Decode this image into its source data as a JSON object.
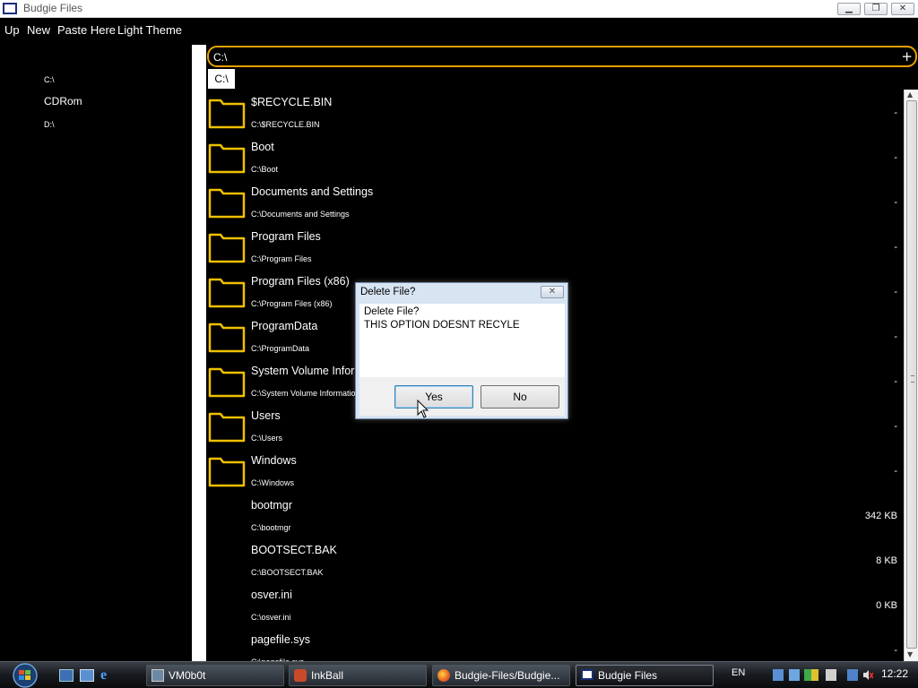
{
  "window": {
    "title": "Budgie Files"
  },
  "menu": {
    "up": "Up",
    "new": "New",
    "paste_here": "Paste Here",
    "light_theme": "Light Theme"
  },
  "sidebar": {
    "drives": [
      {
        "label": "C:\\"
      },
      {
        "label": "CDRom"
      },
      {
        "label": "D:\\"
      }
    ]
  },
  "path": {
    "value": "C:\\",
    "add_label": "+",
    "breadcrumb": "C:\\"
  },
  "files": [
    {
      "name": "$RECYCLE.BIN",
      "path": "C:\\$RECYCLE.BIN",
      "size": "-",
      "is_folder": true
    },
    {
      "name": "Boot",
      "path": "C:\\Boot",
      "size": "-",
      "is_folder": true
    },
    {
      "name": "Documents and Settings",
      "path": "C:\\Documents and Settings",
      "size": "-",
      "is_folder": true
    },
    {
      "name": "Program Files",
      "path": "C:\\Program Files",
      "size": "-",
      "is_folder": true
    },
    {
      "name": "Program Files (x86)",
      "path": "C:\\Program Files (x86)",
      "size": "-",
      "is_folder": true
    },
    {
      "name": "ProgramData",
      "path": "C:\\ProgramData",
      "size": "-",
      "is_folder": true
    },
    {
      "name": "System Volume Information",
      "path": "C:\\System Volume Information",
      "size": "-",
      "is_folder": true
    },
    {
      "name": "Users",
      "path": "C:\\Users",
      "size": "-",
      "is_folder": true
    },
    {
      "name": "Windows",
      "path": "C:\\Windows",
      "size": "-",
      "is_folder": true
    },
    {
      "name": "bootmgr",
      "path": "C:\\bootmgr",
      "size": "342 KB",
      "is_folder": false
    },
    {
      "name": "BOOTSECT.BAK",
      "path": "C:\\BOOTSECT.BAK",
      "size": "8 KB",
      "is_folder": false
    },
    {
      "name": "osver.ini",
      "path": "C:\\osver.ini",
      "size": "0 KB",
      "is_folder": false
    },
    {
      "name": "pagefile.sys",
      "path": "C:\\pagefile.sys",
      "size": "-",
      "is_folder": false
    }
  ],
  "dialog": {
    "title": "Delete File?",
    "close_label": "✕",
    "message_line1": "Delete File?",
    "message_line2": "THIS OPTION DOESNT RECYLE",
    "yes_label": "Yes",
    "no_label": "No"
  },
  "taskbar": {
    "tasks": [
      {
        "label": "VM0b0t",
        "icon": "vm-icon"
      },
      {
        "label": "InkBall",
        "icon": "inkball-icon"
      },
      {
        "label": "Budgie-Files/Budgie...",
        "icon": "firefox-icon"
      },
      {
        "label": "Budgie Files",
        "icon": "budgie-files-icon"
      }
    ],
    "language": "EN",
    "clock": "12:22"
  },
  "colors": {
    "accent": "#e8a000",
    "folder": "#f0c000",
    "background": "#000000"
  }
}
